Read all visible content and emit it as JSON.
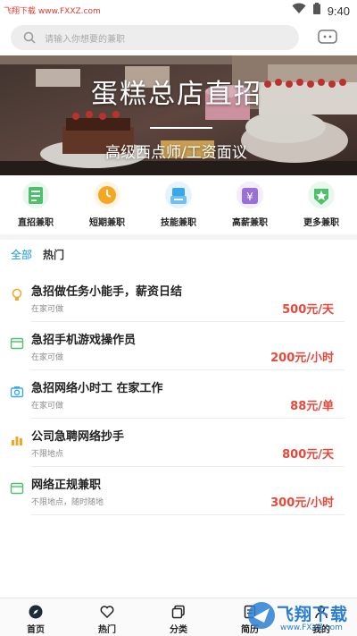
{
  "status": {
    "watermark": "飞翔下载 www.FXXZ.com",
    "time": "9:40"
  },
  "search": {
    "placeholder": "请输入你想要的兼职"
  },
  "banner": {
    "title": "蛋糕总店直招",
    "subtitle": "高级西点师/工资面议"
  },
  "categories": [
    {
      "label": "直招兼职",
      "icon": "document-icon",
      "color": "#4cc06a"
    },
    {
      "label": "短期兼职",
      "icon": "clock-icon",
      "color": "#f5a623"
    },
    {
      "label": "技能兼职",
      "icon": "skills-icon",
      "color": "#3aa8e8"
    },
    {
      "label": "高薪兼职",
      "icon": "yen-icon",
      "color": "#9b6fd8"
    },
    {
      "label": "更多兼职",
      "icon": "star-icon",
      "color": "#4cc06a"
    }
  ],
  "tabs": [
    {
      "label": "全部",
      "active": true
    },
    {
      "label": "热门",
      "active": false
    }
  ],
  "jobs": [
    {
      "title": "急招做任务小能手，薪资日结",
      "location": "在家可做",
      "pay": "500元/天",
      "icon": "lightbulb-icon",
      "color": "#f5a623"
    },
    {
      "title": "急招手机游戏操作员",
      "location": "在家可做",
      "pay": "200元/小时",
      "icon": "card-icon",
      "color": "#4cc06a"
    },
    {
      "title": "急招网络小时工 在家工作",
      "location": "在家可做",
      "pay": "88元/单",
      "icon": "camera-icon",
      "color": "#3aa8e8"
    },
    {
      "title": "公司急聘网络抄手",
      "location": "不限地点",
      "pay": "800元/天",
      "icon": "bar-chart-icon",
      "color": "#f5a623"
    },
    {
      "title": "网络正规兼职",
      "location": "不限地点，随时随地",
      "pay": "300元/小时",
      "icon": "card-icon",
      "color": "#4cc06a"
    }
  ],
  "nav": [
    {
      "label": "首页",
      "icon": "compass-icon"
    },
    {
      "label": "热门",
      "icon": "heart-icon"
    },
    {
      "label": "分类",
      "icon": "layers-icon"
    },
    {
      "label": "简历",
      "icon": "resume-icon"
    },
    {
      "label": "我的",
      "icon": "user-icon"
    }
  ],
  "logo": {
    "text": "飞翔下载",
    "url": "www.FXXZ.com"
  },
  "colors": {
    "accent": "#1296db",
    "price": "#e8473a"
  }
}
